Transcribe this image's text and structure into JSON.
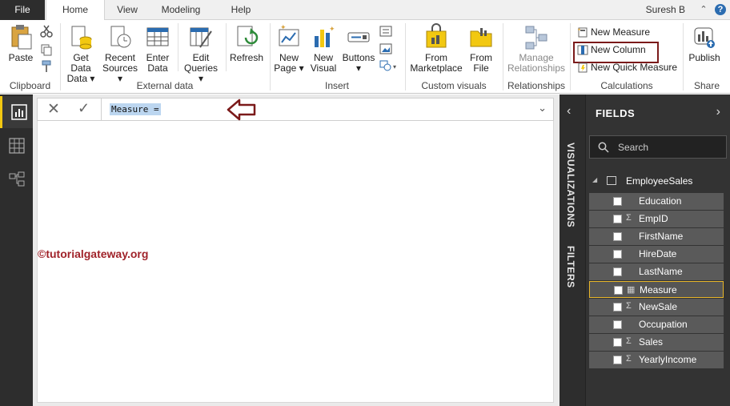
{
  "tabs": {
    "file": "File",
    "items": [
      "Home",
      "View",
      "Modeling",
      "Help"
    ],
    "active": "Home"
  },
  "user": "Suresh B",
  "ribbon": {
    "clipboard": {
      "paste": "Paste",
      "group": "Clipboard"
    },
    "external_data": {
      "get_data": "Get Data",
      "get_data_2": "",
      "recent_sources": "Recent",
      "recent_sources_2": "Sources",
      "enter_data": "Enter",
      "enter_data_2": "Data",
      "edit_queries": "Edit",
      "edit_queries_2": "Queries",
      "refresh": "Refresh",
      "group": "External data"
    },
    "insert": {
      "new_page": "New",
      "new_page_2": "Page",
      "new_visual": "New",
      "new_visual_2": "Visual",
      "buttons": "Buttons",
      "group": "Insert"
    },
    "custom_visuals": {
      "from_marketplace": "From",
      "from_marketplace_2": "Marketplace",
      "from_file": "From",
      "from_file_2": "File",
      "group": "Custom visuals"
    },
    "relationships": {
      "manage": "Manage",
      "manage_2": "Relationships",
      "group": "Relationships"
    },
    "calculations": {
      "new_measure": "New Measure",
      "new_column": "New Column",
      "new_quick_measure": "New Quick Measure",
      "group": "Calculations"
    },
    "share": {
      "publish": "Publish",
      "group": "Share"
    }
  },
  "formula_bar": {
    "text": "Measure = "
  },
  "watermark": "©tutorialgateway.org",
  "rail": {
    "visualizations": "VISUALIZATIONS",
    "filters": "FILTERS"
  },
  "fields_pane": {
    "title": "FIELDS",
    "search_placeholder": "Search",
    "table": "EmployeeSales",
    "fields": [
      {
        "name": "Education",
        "sigma": false,
        "selected": false
      },
      {
        "name": "EmpID",
        "sigma": true,
        "selected": false
      },
      {
        "name": "FirstName",
        "sigma": false,
        "selected": false
      },
      {
        "name": "HireDate",
        "sigma": false,
        "selected": false
      },
      {
        "name": "LastName",
        "sigma": false,
        "selected": false
      },
      {
        "name": "Measure",
        "sigma": false,
        "calc": true,
        "selected": true
      },
      {
        "name": "NewSale",
        "sigma": true,
        "selected": false
      },
      {
        "name": "Occupation",
        "sigma": false,
        "selected": false
      },
      {
        "name": "Sales",
        "sigma": true,
        "selected": false
      },
      {
        "name": "YearlyIncome",
        "sigma": true,
        "selected": false
      }
    ]
  },
  "colors": {
    "accent_highlight": "#7b1a1a",
    "nav_active": "#f2c811",
    "fields_bg": "#333333",
    "selection": "#bcd6f0"
  }
}
